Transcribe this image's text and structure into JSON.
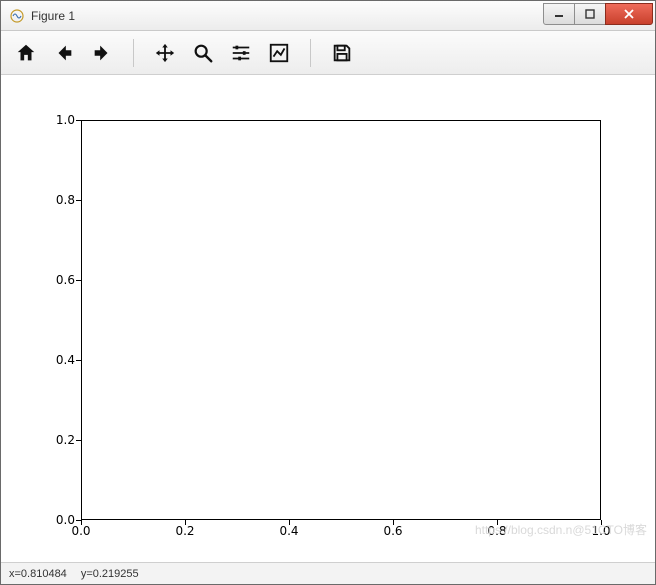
{
  "window": {
    "title": "Figure 1"
  },
  "toolbar": {
    "home": "Home",
    "back": "Back",
    "forward": "Forward",
    "pan": "Pan",
    "zoom": "Zoom",
    "subplots": "Configure subplots",
    "axes": "Edit axis",
    "save": "Save"
  },
  "status": {
    "x_label": "x=0.810484",
    "y_label": "y=0.219255"
  },
  "watermark": "https://blog.csdn.n@51CTO博客",
  "chart_data": {
    "type": "line",
    "title": "",
    "xlabel": "",
    "ylabel": "",
    "xlim": [
      0.0,
      1.0
    ],
    "ylim": [
      0.0,
      1.0
    ],
    "xticks": [
      0.0,
      0.2,
      0.4,
      0.6,
      0.8,
      1.0
    ],
    "yticks": [
      0.0,
      0.2,
      0.4,
      0.6,
      0.8,
      1.0
    ],
    "series": []
  }
}
